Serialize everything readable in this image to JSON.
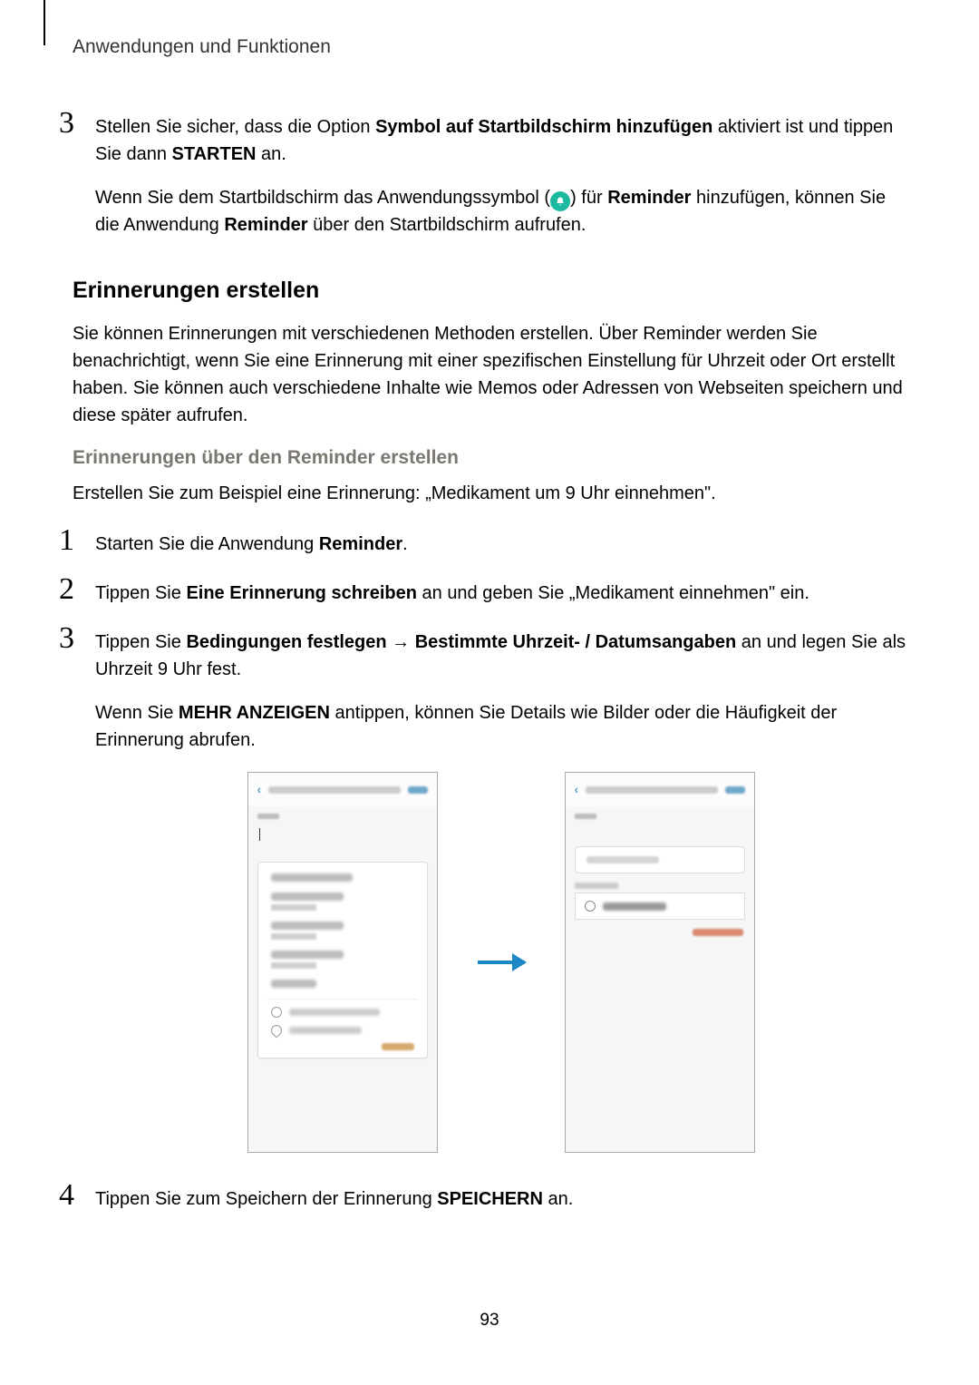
{
  "header": "Anwendungen und Funktionen",
  "page_number": "93",
  "step3_top": {
    "num": "3",
    "p1_a": "Stellen Sie sicher, dass die Option ",
    "p1_b": "Symbol auf Startbildschirm hinzufügen",
    "p1_c": " aktiviert ist und tippen Sie dann ",
    "p1_d": "STARTEN",
    "p1_e": " an.",
    "p2_a": "Wenn Sie dem Startbildschirm das Anwendungssymbol (",
    "p2_b": ") für ",
    "p2_c": "Reminder",
    "p2_d": " hinzufügen, können Sie die Anwendung ",
    "p2_e": "Reminder",
    "p2_f": " über den Startbildschirm aufrufen."
  },
  "h2": "Erinnerungen erstellen",
  "para1": "Sie können Erinnerungen mit verschiedenen Methoden erstellen. Über Reminder werden Sie benachrichtigt, wenn Sie eine Erinnerung mit einer spezifischen Einstellung für Uhrzeit oder Ort erstellt haben. Sie können auch verschiedene Inhalte wie Memos oder Adressen von Webseiten speichern und diese später aufrufen.",
  "h3": "Erinnerungen über den Reminder erstellen",
  "para2": "Erstellen Sie zum Beispiel eine Erinnerung: „Medikament um 9 Uhr einnehmen\".",
  "step1": {
    "num": "1",
    "a": "Starten Sie die Anwendung ",
    "b": "Reminder",
    "c": "."
  },
  "step2": {
    "num": "2",
    "a": "Tippen Sie ",
    "b": "Eine Erinnerung schreiben",
    "c": " an und geben Sie „Medikament einnehmen\" ein."
  },
  "step3": {
    "num": "3",
    "a": "Tippen Sie ",
    "b": "Bedingungen festlegen",
    "arrow": " → ",
    "c": "Bestimmte Uhrzeit- / Datumsangaben",
    "d": " an und legen Sie als Uhrzeit 9 Uhr fest.",
    "p2_a": "Wenn Sie ",
    "p2_b": "MEHR ANZEIGEN",
    "p2_c": " antippen, können Sie Details wie Bilder oder die Häufigkeit der Erinnerung abrufen."
  },
  "step4": {
    "num": "4",
    "a": "Tippen Sie zum Speichern der Erinnerung ",
    "b": "SPEICHERN",
    "c": " an."
  }
}
